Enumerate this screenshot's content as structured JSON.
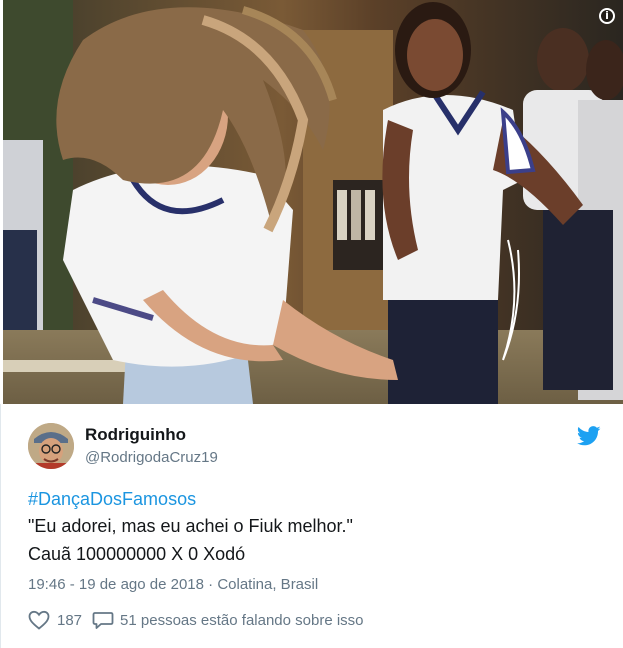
{
  "media": {
    "info_badge": "i",
    "alt": "Photo of two girls in white school uniforms dancing"
  },
  "tweet": {
    "display_name": "Rodriguinho",
    "handle": "@RodrigodaCruz19",
    "hashtag": "#DançaDosFamosos",
    "text_line_1": "\"Eu adorei, mas eu achei o Fiuk melhor.\"",
    "text_line_2": "Cauã 100000000 X 0 Xodó",
    "meta": "19:46 - 19 de ago de 2018 · Colatina, Brasil",
    "like_count": "187",
    "reply_text": "51 pessoas estão falando sobre isso"
  },
  "icons": {
    "twitter": "twitter-bird-icon",
    "like": "heart-icon",
    "reply": "speech-bubble-icon",
    "info": "info-icon"
  },
  "colors": {
    "link": "#1b95e0",
    "text": "#14171a",
    "muted": "#657786",
    "twitter_blue": "#1da1f2"
  }
}
